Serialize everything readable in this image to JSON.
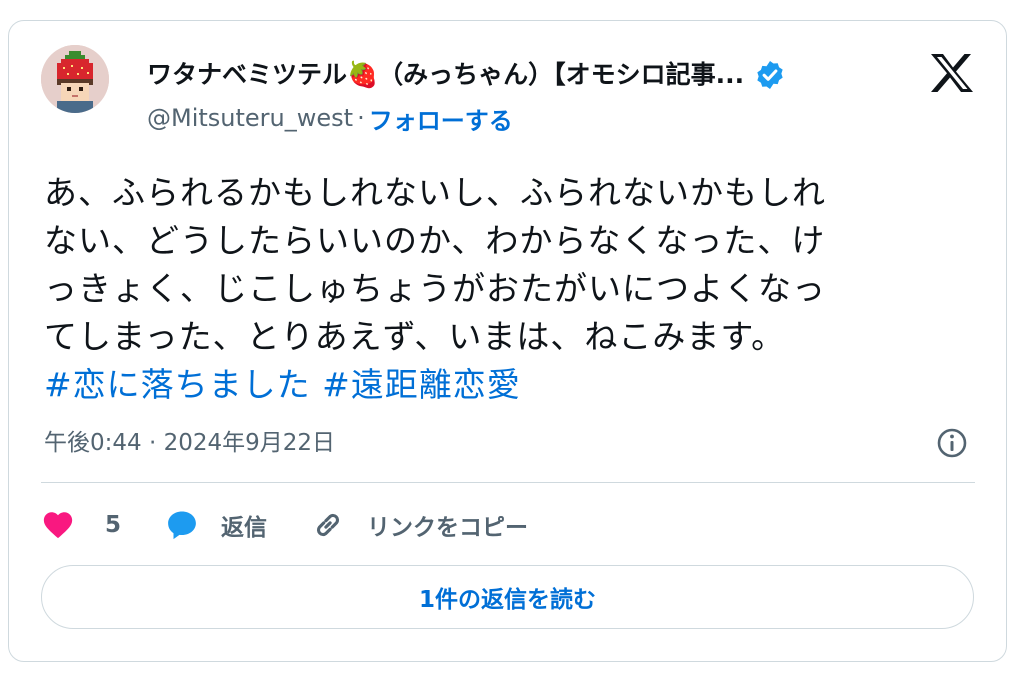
{
  "author": {
    "display_name": "ワタナベミツテル🍓（みっちゃん）【オモシロ記事...",
    "handle": "@Mitsuteru_west",
    "separator": "·",
    "follow_label": "フォローする",
    "verified_icon": "verified-badge-icon"
  },
  "tweet": {
    "lines": [
      "あ、ふられるかもしれないし、ふられないかもしれ",
      "ない、どうしたらいいのか、わからなくなった、け",
      "っきょく、じこしゅちょうがおたがいにつよくなっ",
      "てしまった、とりあえず、いまは、ねこみます。"
    ],
    "hashtags": [
      "#恋に落ちました",
      "#遠距離恋愛"
    ]
  },
  "meta": {
    "timestamp": "午後0:44 · 2024年9月22日"
  },
  "actions": {
    "like_count": "5",
    "reply_label": "返信",
    "copy_link_label": "リンクをコピー"
  },
  "read_replies_label": "1件の返信を読む",
  "colors": {
    "link": "#006fd6",
    "text": "#0f1419",
    "muted": "#536471",
    "border": "#cfd9de",
    "like": "#f91880",
    "reply": "#1d9bf0",
    "verified": "#1d9bf0"
  }
}
